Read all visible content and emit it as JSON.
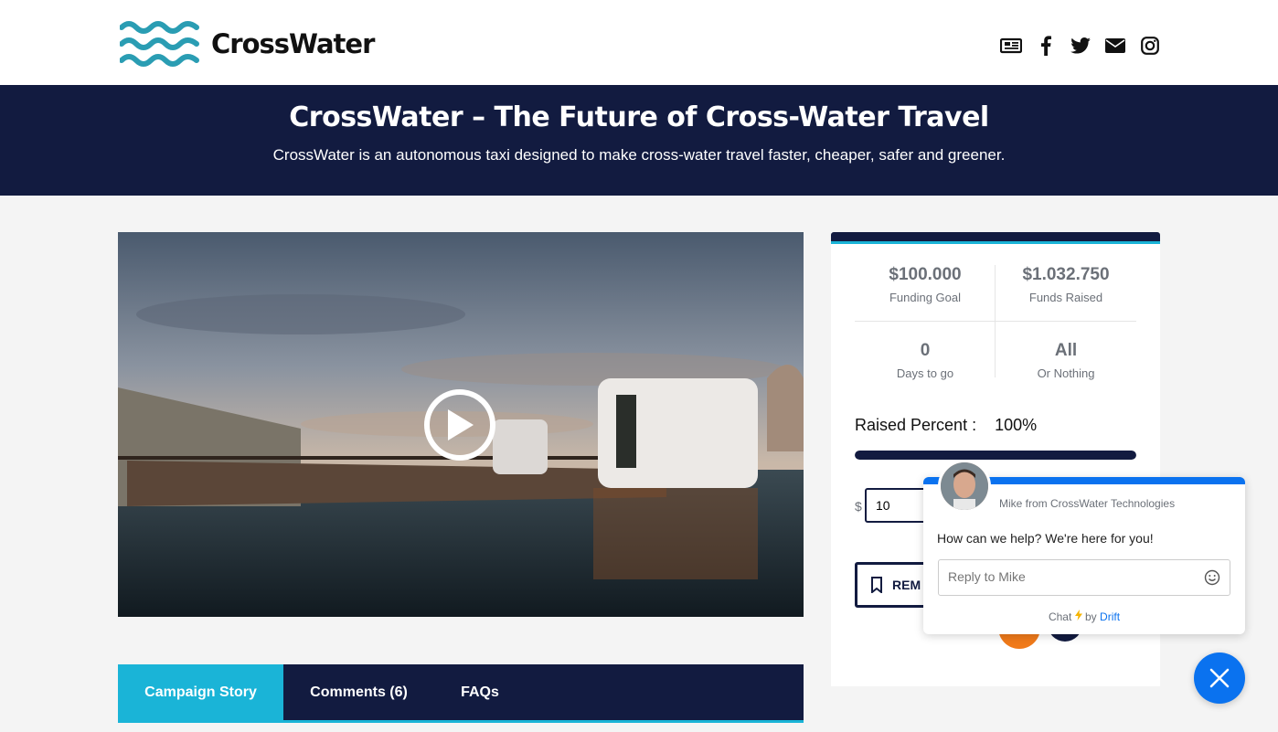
{
  "brand": {
    "name": "CrossWater"
  },
  "header": {
    "social_icons": [
      "newspaper-icon",
      "facebook-icon",
      "twitter-icon",
      "envelope-icon",
      "instagram-icon"
    ]
  },
  "hero": {
    "title": "CrossWater – The Future of Cross-Water Travel",
    "subtitle": "CrossWater is an autonomous taxi designed to make cross-water travel faster, cheaper, safer and greener."
  },
  "tabs": [
    {
      "label": "Campaign Story",
      "active": true
    },
    {
      "label": "Comments (6)",
      "active": false
    },
    {
      "label": "FAQs",
      "active": false
    }
  ],
  "stats": {
    "goal_value": "$100.000",
    "goal_label": "Funding Goal",
    "raised_value": "$1.032.750",
    "raised_label": "Funds Raised",
    "days_value": "0",
    "days_label": "Days to go",
    "type_value": "All",
    "type_label": "Or Nothing",
    "raised_percent_label": "Raised Percent :",
    "raised_percent_value": "100%",
    "progress_fraction": 1.0
  },
  "pledge": {
    "currency": "$",
    "amount": "10",
    "remind_label": "REM"
  },
  "chat": {
    "from": "Mike from CrossWater Technologies",
    "message": "How can we help? We're here for you!",
    "placeholder": "Reply to Mike",
    "footer_chat": "Chat",
    "footer_by": "by",
    "footer_brand": "Drift"
  },
  "colors": {
    "navy": "#121b40",
    "accent": "#1ab4d7",
    "chat_blue": "#0a72ef",
    "orange": "#f07a1a"
  }
}
